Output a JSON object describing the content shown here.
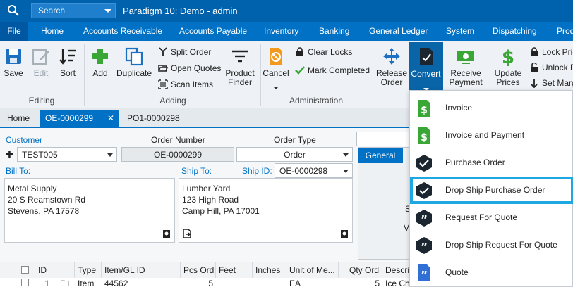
{
  "titlebar": {
    "search_placeholder": "Search",
    "title": "Paradigm 10: Demo - admin"
  },
  "menubar": [
    "File",
    "Home",
    "Accounts Receivable",
    "Accounts Payable",
    "Inventory",
    "Banking",
    "General Ledger",
    "System",
    "Dispatching",
    "Prod"
  ],
  "ribbon": {
    "save": "Save",
    "edit": "Edit",
    "sort": "Sort",
    "editing_group": "Editing",
    "add": "Add",
    "duplicate": "Duplicate",
    "split_order": "Split Order",
    "open_quotes": "Open Quotes",
    "scan_items": "Scan Items",
    "product_finder_1": "Product",
    "product_finder_2": "Finder",
    "adding_group": "Adding",
    "cancel": "Cancel",
    "clear_locks": "Clear Locks",
    "mark_completed": "Mark Completed",
    "administration_group": "Administration",
    "release_order_1": "Release",
    "release_order_2": "Order",
    "convert": "Convert",
    "receive_payment_1": "Receive",
    "receive_payment_2": "Payment",
    "update_prices_1": "Update",
    "update_prices_2": "Prices",
    "lock_prices": "Lock Pric",
    "unlock_prices": "Unlock P",
    "set_margin": "Set Marg"
  },
  "doctabs": [
    "Home",
    "OE-0000299",
    "PO1-0000298"
  ],
  "form": {
    "customer_label": "Customer",
    "customer_value": "TEST005",
    "order_number_label": "Order Number",
    "order_number_value": "OE-0000299",
    "order_type_label": "Order Type",
    "order_type_value": "Order",
    "bill_to_label": "Bill To:",
    "bill_to_lines": [
      "Metal Supply",
      "20 S Reamstown Rd",
      "Stevens, PA 17578"
    ],
    "ship_to_label": "Ship To:",
    "ship_id_label": "Ship ID:",
    "ship_id_value": "OE-0000298",
    "ship_to_lines": [
      "Lumber Yard",
      "123 High Road",
      "Camp Hill, PA 17001"
    ],
    "general_tab": "General",
    "side_letters": [
      "S",
      "V"
    ]
  },
  "grid": {
    "headers": [
      "ID",
      "Type",
      "Item/GL ID",
      "Pcs Ord",
      "Feet",
      "Inches",
      "Unit of Me...",
      "Qty Ord",
      "Descrip"
    ],
    "row": [
      "1",
      "Item",
      "44562",
      "5",
      "",
      "",
      "EA",
      "5",
      "Ice Che"
    ]
  },
  "convert_menu": [
    "Invoice",
    "Invoice and Payment",
    "Purchase Order",
    "Drop Ship Purchase Order",
    "Request For Quote",
    "Drop Ship Request For Quote",
    "Quote"
  ],
  "colors": {
    "titlebar": "#0062ad",
    "menubar": "#0071c5",
    "highlight": "#1ea7e1",
    "green": "#3aa635"
  }
}
